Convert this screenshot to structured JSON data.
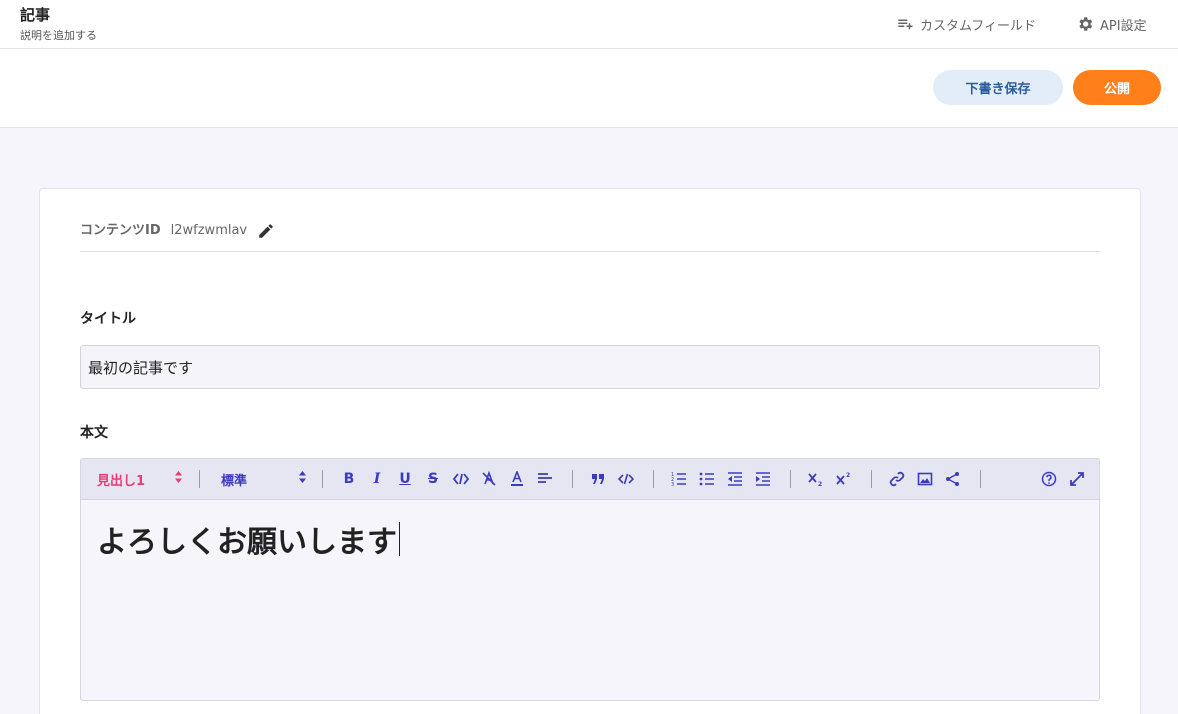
{
  "header": {
    "title": "記事",
    "subtitle": "説明を追加する",
    "custom_fields_label": "カスタムフィールド",
    "api_settings_label": "API設定",
    "icons": {
      "custom_fields": "playlist-add-icon",
      "api_settings": "gear-icon"
    }
  },
  "actions": {
    "save_draft_label": "下書き保存",
    "publish_label": "公開"
  },
  "content": {
    "id_label": "コンテンツID",
    "id_value": "l2wfzwmlav",
    "title_label": "タイトル",
    "title_value": "最初の記事です",
    "body_label": "本文",
    "body_text": "よろしくお願いします"
  },
  "toolbar": {
    "heading_select": "見出し1",
    "style_select": "標準",
    "buttons": [
      "bold",
      "italic",
      "underline",
      "strikethrough",
      "inline-code",
      "clear-format",
      "text-color",
      "align",
      "blockquote",
      "code-block",
      "ordered-list",
      "bullet-list",
      "outdent",
      "indent",
      "subscript",
      "superscript",
      "link",
      "image",
      "share",
      "help",
      "fullscreen"
    ]
  },
  "colors": {
    "accent": "#ff7f1a",
    "draft_bg": "#e3edf8",
    "toolbar_icon": "#3b3bbf",
    "heading_select": "#e73c72"
  }
}
